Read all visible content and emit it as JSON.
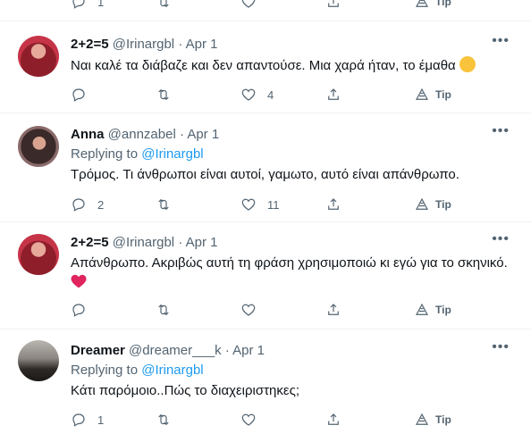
{
  "tweets": [
    {
      "name": "",
      "handle": "",
      "date": "",
      "replying_prefix": "",
      "replying_to": "",
      "text": "",
      "replies": "1",
      "retweets": "",
      "likes": "",
      "tip": "Tip"
    },
    {
      "name": "2+2=5",
      "handle": "@Irinargbl",
      "date": "Apr 1",
      "replying_prefix": "",
      "replying_to": "",
      "text": "Ναι καλέ τα διάβαζε και δεν απαντούσε. Μια χαρά ήταν, το έμαθα",
      "replies": "",
      "retweets": "",
      "likes": "4",
      "tip": "Tip"
    },
    {
      "name": "Anna",
      "handle": "@annzabel",
      "date": "Apr 1",
      "replying_prefix": "Replying to",
      "replying_to": "@Irinargbl",
      "text": "Τρόμος. Τι άνθρωποι είναι αυτοί, γαμωτο, αυτό είναι απάνθρωπο.",
      "replies": "2",
      "retweets": "",
      "likes": "11",
      "tip": "Tip"
    },
    {
      "name": "2+2=5",
      "handle": "@Irinargbl",
      "date": "Apr 1",
      "replying_prefix": "",
      "replying_to": "",
      "text": "Απάνθρωπο. Ακριβώς αυτή τη φράση χρησιμοποιώ κι εγώ για το σκηνικό.",
      "replies": "",
      "retweets": "",
      "likes": "",
      "tip": "Tip"
    },
    {
      "name": "Dreamer",
      "handle": "@dreamer___k",
      "date": "Apr 1",
      "replying_prefix": "Replying to",
      "replying_to": "@Irinargbl",
      "text": "Κάτι παρόμοιο..Πώς το διαχειριστηκες;",
      "replies": "1",
      "retweets": "",
      "likes": "",
      "tip": "Tip"
    }
  ],
  "separator": "·",
  "more_glyph": "•••"
}
